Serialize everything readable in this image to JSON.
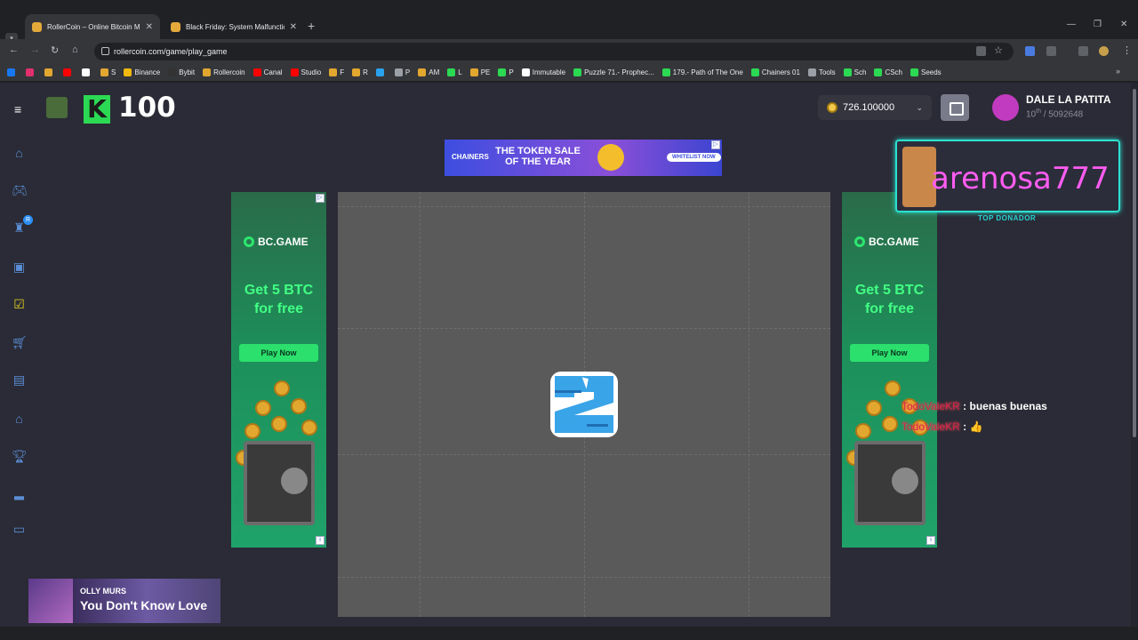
{
  "browser": {
    "tabs": [
      {
        "title": "RollerCoin – Online Bitcoin Min",
        "active": true
      },
      {
        "title": "Black Friday: System Malfunctio",
        "active": false
      }
    ],
    "url": "rollercoin.com/game/play_game",
    "bookmarks": [
      {
        "label": "",
        "color": "#1877f2"
      },
      {
        "label": "",
        "color": "#e1306c"
      },
      {
        "label": "",
        "color": "#e2a72e"
      },
      {
        "label": "",
        "color": "#ff0000"
      },
      {
        "label": "",
        "color": "#ffffff"
      },
      {
        "label": "S",
        "color": "#e2a72e"
      },
      {
        "label": "Binance",
        "color": "#f0b90b"
      },
      {
        "label": "Bybit",
        "color": "#333333"
      },
      {
        "label": "Rollercoin",
        "color": "#e2a72e"
      },
      {
        "label": "Canal",
        "color": "#ff0000"
      },
      {
        "label": "Studio",
        "color": "#ff0000"
      },
      {
        "label": "F",
        "color": "#e2a72e"
      },
      {
        "label": "R",
        "color": "#e2a72e"
      },
      {
        "label": "",
        "color": "#2aa3ef"
      },
      {
        "label": "P",
        "color": "#9aa0a6"
      },
      {
        "label": "AM",
        "color": "#e2a72e"
      },
      {
        "label": "L",
        "color": "#2bd952"
      },
      {
        "label": "PE",
        "color": "#e2a72e"
      },
      {
        "label": "P",
        "color": "#2bd952"
      },
      {
        "label": "Immutable",
        "color": "#ffffff"
      },
      {
        "label": "Puzzle 71.- Prophec...",
        "color": "#2bd952"
      },
      {
        "label": "179.- Path of The One",
        "color": "#2bd952"
      },
      {
        "label": "Chainers 01",
        "color": "#2bd952"
      },
      {
        "label": "Tools",
        "color": "#9aa0a6"
      },
      {
        "label": "Sch",
        "color": "#2bd952"
      },
      {
        "label": "CSch",
        "color": "#2bd952"
      },
      {
        "label": "Seeds",
        "color": "#2bd952"
      }
    ]
  },
  "header": {
    "level_value": "100",
    "balance": "726.100000",
    "user_name": "DALE LA PATITA",
    "user_rank_num": "10",
    "user_rank_suffix": "th",
    "user_rank_total": " / 5092648"
  },
  "top_ad": {
    "brand": "CHAINERS",
    "headline": "THE TOKEN SALE OF THE YEAR",
    "cta": "WHITELIST NOW"
  },
  "side_ad": {
    "brand": "BC.GAME",
    "promo_line1": "Get 5 BTC",
    "promo_line2": "for free",
    "cta": "Play Now"
  },
  "game": {
    "countdown": "2"
  },
  "donor": {
    "name": "arenosa777",
    "label": "TOP DONADOR"
  },
  "chat": [
    {
      "user": "TodoValeKR",
      "message": " : buenas buenas"
    },
    {
      "user": "TodoValeKR",
      "message": " : 👍"
    }
  ],
  "music": {
    "artist": "OLLY MURS",
    "song": "You Don't Know Love"
  }
}
